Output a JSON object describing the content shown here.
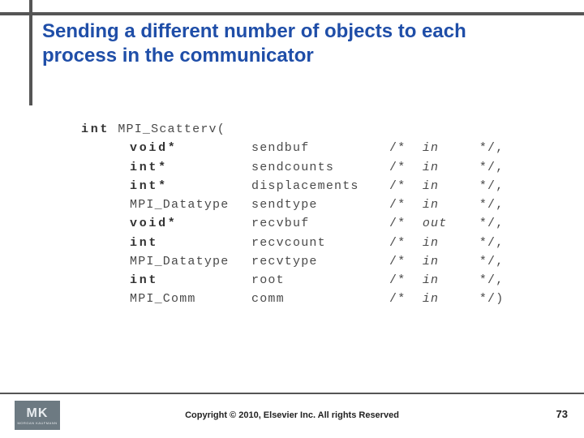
{
  "title": "Sending a different number of objects to each process in the communicator",
  "function": {
    "return_type": "int",
    "name": "MPI_Scatterv("
  },
  "params": [
    {
      "type": "void*",
      "type_bold": true,
      "name": "sendbuf",
      "dir": "in",
      "term": "*/,"
    },
    {
      "type": "int*",
      "type_bold": true,
      "name": "sendcounts",
      "dir": "in",
      "term": "*/,"
    },
    {
      "type": "int*",
      "type_bold": true,
      "name": "displacements",
      "dir": "in",
      "term": "*/,"
    },
    {
      "type": "MPI_Datatype",
      "type_bold": false,
      "name": "sendtype",
      "dir": "in",
      "term": "*/,"
    },
    {
      "type": "void*",
      "type_bold": true,
      "name": "recvbuf",
      "dir": "out",
      "term": "*/,"
    },
    {
      "type": "int",
      "type_bold": true,
      "name": "recvcount",
      "dir": "in",
      "term": "*/,"
    },
    {
      "type": "MPI_Datatype",
      "type_bold": false,
      "name": "recvtype",
      "dir": "in",
      "term": "*/,"
    },
    {
      "type": "int",
      "type_bold": true,
      "name": "root",
      "dir": "in",
      "term": "*/,"
    },
    {
      "type": "MPI_Comm",
      "type_bold": false,
      "name": "comm",
      "dir": "in",
      "term": "*/)"
    }
  ],
  "copyright": "Copyright © 2010, Elsevier Inc. All rights Reserved",
  "page_number": "73",
  "logo": {
    "main": "MK",
    "sub": "MORGAN KAUFMANN"
  },
  "comment_open": "/*"
}
